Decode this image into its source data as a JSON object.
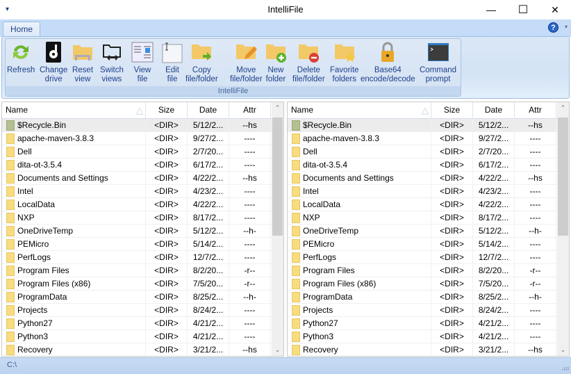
{
  "window": {
    "title": "IntelliFile",
    "qat": "▾",
    "minimize": "—",
    "maximize": "☐",
    "close": "✕"
  },
  "ribbon": {
    "tab": "Home",
    "help": "?",
    "help_dropdown": "▾",
    "group_label": "IntelliFile",
    "buttons": [
      {
        "l1": "Refresh",
        "l2": "",
        "icon": "refresh-icon"
      },
      {
        "l1": "Change",
        "l2": "drive",
        "icon": "drive-icon"
      },
      {
        "l1": "Reset",
        "l2": "view",
        "icon": "reset-view-icon"
      },
      {
        "l1": "Switch",
        "l2": "views",
        "icon": "switch-views-icon"
      },
      {
        "l1": "View",
        "l2": "file",
        "icon": "view-file-icon"
      },
      {
        "l1": "Edit",
        "l2": "file",
        "icon": "edit-file-icon"
      },
      {
        "l1": "Copy",
        "l2": "file/folder",
        "icon": "copy-folder-icon"
      },
      {
        "l1": "Move",
        "l2": "file/folder",
        "icon": "move-folder-icon"
      },
      {
        "l1": "New",
        "l2": "folder",
        "icon": "new-folder-icon"
      },
      {
        "l1": "Delete",
        "l2": "file/folder",
        "icon": "delete-folder-icon"
      },
      {
        "l1": "Favorite",
        "l2": "folders",
        "icon": "favorite-folder-icon"
      },
      {
        "l1": "Base64",
        "l2": "encode/decode",
        "icon": "lock-icon"
      },
      {
        "l1": "Command",
        "l2": "prompt",
        "icon": "terminal-icon"
      }
    ]
  },
  "columns": [
    "Name",
    "Size",
    "Date",
    "Attr"
  ],
  "files": [
    [
      "$Recycle.Bin",
      "<DIR>",
      "5/12/2...",
      "--hs"
    ],
    [
      "apache-maven-3.8.3",
      "<DIR>",
      "9/27/2...",
      "----"
    ],
    [
      "Dell",
      "<DIR>",
      "2/7/20...",
      "----"
    ],
    [
      "dita-ot-3.5.4",
      "<DIR>",
      "6/17/2...",
      "----"
    ],
    [
      "Documents and Settings",
      "<DIR>",
      "4/22/2...",
      "--hs"
    ],
    [
      "Intel",
      "<DIR>",
      "4/23/2...",
      "----"
    ],
    [
      "LocalData",
      "<DIR>",
      "4/22/2...",
      "----"
    ],
    [
      "NXP",
      "<DIR>",
      "8/17/2...",
      "----"
    ],
    [
      "OneDriveTemp",
      "<DIR>",
      "5/12/2...",
      "--h-"
    ],
    [
      "PEMicro",
      "<DIR>",
      "5/14/2...",
      "----"
    ],
    [
      "PerfLogs",
      "<DIR>",
      "12/7/2...",
      "----"
    ],
    [
      "Program Files",
      "<DIR>",
      "8/2/20...",
      "-r--"
    ],
    [
      "Program Files (x86)",
      "<DIR>",
      "7/5/20...",
      "-r--"
    ],
    [
      "ProgramData",
      "<DIR>",
      "8/25/2...",
      "--h-"
    ],
    [
      "Projects",
      "<DIR>",
      "8/24/2...",
      "----"
    ],
    [
      "Python27",
      "<DIR>",
      "4/21/2...",
      "----"
    ],
    [
      "Python3",
      "<DIR>",
      "4/21/2...",
      "----"
    ],
    [
      "Recovery",
      "<DIR>",
      "3/21/2...",
      "--hs"
    ]
  ],
  "status": {
    "path": "C:\\"
  }
}
